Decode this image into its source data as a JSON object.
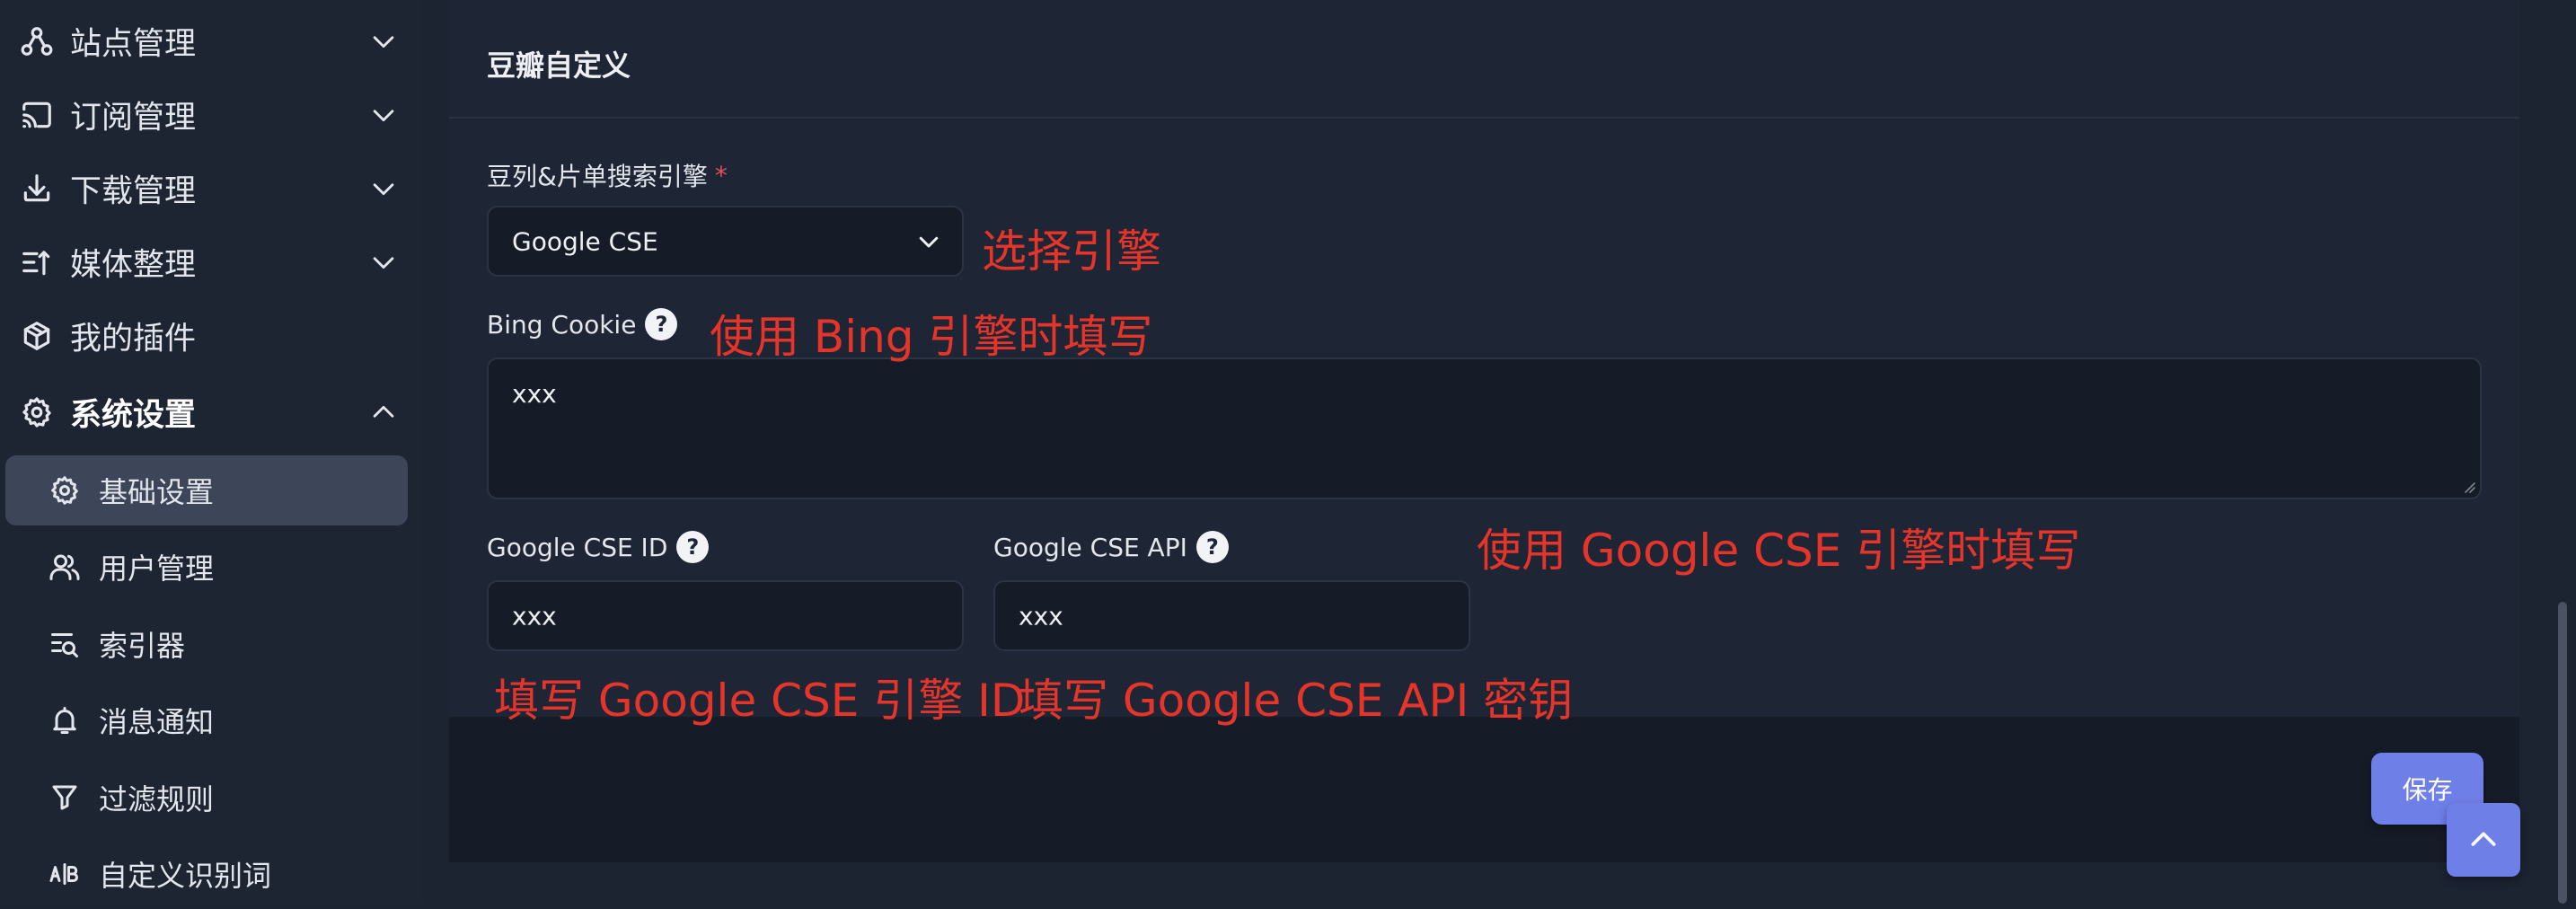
{
  "sidebar": {
    "groups": [
      {
        "label": "站点管理",
        "icon": "site-network-icon",
        "expanded": false
      },
      {
        "label": "订阅管理",
        "icon": "cast-icon",
        "expanded": false
      },
      {
        "label": "下载管理",
        "icon": "download-icon",
        "expanded": false
      },
      {
        "label": "媒体整理",
        "icon": "sort-list-icon",
        "expanded": false
      },
      {
        "label": "我的插件",
        "icon": "package-icon"
      },
      {
        "label": "系统设置",
        "icon": "gear-icon",
        "expanded": true
      }
    ],
    "sub_items": [
      {
        "label": "基础设置",
        "icon": "gear-icon",
        "selected": true
      },
      {
        "label": "用户管理",
        "icon": "users-icon"
      },
      {
        "label": "索引器",
        "icon": "list-search-icon"
      },
      {
        "label": "消息通知",
        "icon": "bell-icon"
      },
      {
        "label": "过滤规则",
        "icon": "filter-icon"
      },
      {
        "label": "自定义识别词",
        "icon": "ab-icon"
      }
    ]
  },
  "card": {
    "title": "豆瓣自定义",
    "engine": {
      "label": "豆列&片单搜索引擎",
      "required_mark": "*",
      "value": "Google CSE"
    },
    "bing_cookie": {
      "label": "Bing Cookie",
      "help": "?",
      "value": "xxx"
    },
    "cse_id": {
      "label": "Google CSE ID",
      "help": "?",
      "value": "xxx"
    },
    "cse_api": {
      "label": "Google CSE API",
      "help": "?",
      "value": "xxx"
    },
    "save_label": "保存"
  },
  "annotations": {
    "select_engine": "选择引擎",
    "bing_hint": "使用 Bing 引擎时填写",
    "google_hint": "使用 Google CSE 引擎时填写",
    "cse_id_hint": "填写 Google CSE 引擎 ID",
    "cse_api_hint": "填写 Google CSE API 密钥"
  },
  "colors": {
    "background": "#1c2331",
    "accent": "#6f7fe8",
    "annotation": "#e5352b",
    "selected_item": "#3d4659"
  }
}
